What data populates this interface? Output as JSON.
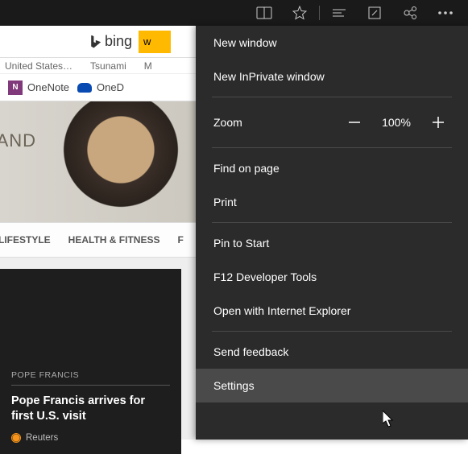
{
  "titlebar": {
    "icons": [
      "reading-view",
      "favorites",
      "hub",
      "webnote",
      "share",
      "more"
    ]
  },
  "search": {
    "brand": "bing",
    "input_value": "w"
  },
  "tabs": [
    "United States…",
    "Tsunami",
    "M"
  ],
  "favorites": {
    "onenote": "OneNote",
    "onedrive": "OneD"
  },
  "hero": {
    "headline_fragment": "TY AND"
  },
  "nav": [
    "LIFESTYLE",
    "HEALTH & FITNESS",
    "F"
  ],
  "story": {
    "tag": "POPE FRANCIS",
    "title": "Pope Francis arrives for first U.S. visit",
    "source": "Reuters"
  },
  "menu": {
    "new_window": "New window",
    "new_inprivate": "New InPrivate window",
    "zoom_label": "Zoom",
    "zoom_value": "100%",
    "find": "Find on page",
    "print": "Print",
    "pin": "Pin to Start",
    "devtools": "F12 Developer Tools",
    "open_ie": "Open with Internet Explorer",
    "feedback": "Send feedback",
    "settings": "Settings"
  }
}
